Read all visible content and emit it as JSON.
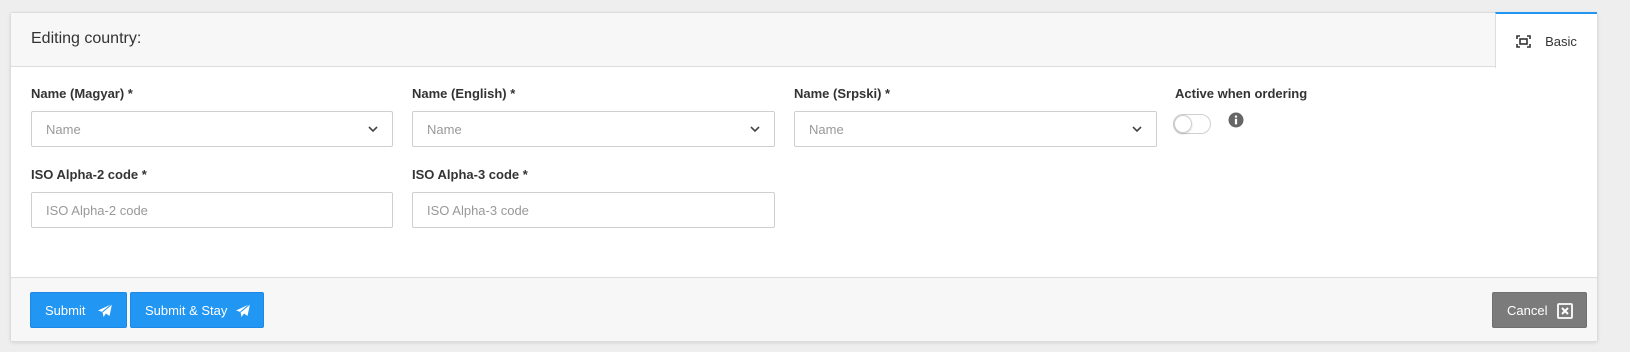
{
  "header": {
    "title": "Editing country:",
    "tab_basic_label": "Basic",
    "tab_icon": "expand-icon"
  },
  "form": {
    "name_hu": {
      "label": "Name (Magyar) *",
      "placeholder": "Name"
    },
    "name_en": {
      "label": "Name (English) *",
      "placeholder": "Name"
    },
    "name_sr": {
      "label": "Name (Srpski) *",
      "placeholder": "Name"
    },
    "active": {
      "label": "Active when ordering",
      "checked": false,
      "info_icon": "info-icon"
    },
    "iso2": {
      "label": "ISO Alpha-2 code *",
      "placeholder": "ISO Alpha-2 code",
      "value": ""
    },
    "iso3": {
      "label": "ISO Alpha-3 code *",
      "placeholder": "ISO Alpha-3 code",
      "value": ""
    }
  },
  "footer": {
    "submit_label": "Submit",
    "submit_stay_label": "Submit & Stay",
    "cancel_label": "Cancel",
    "submit_icon": "paper-plane-icon",
    "cancel_icon": "close-box-icon"
  },
  "colors": {
    "primary": "#2196f3",
    "cancel": "#7b7b7b",
    "header_bg": "#f7f7f7"
  }
}
